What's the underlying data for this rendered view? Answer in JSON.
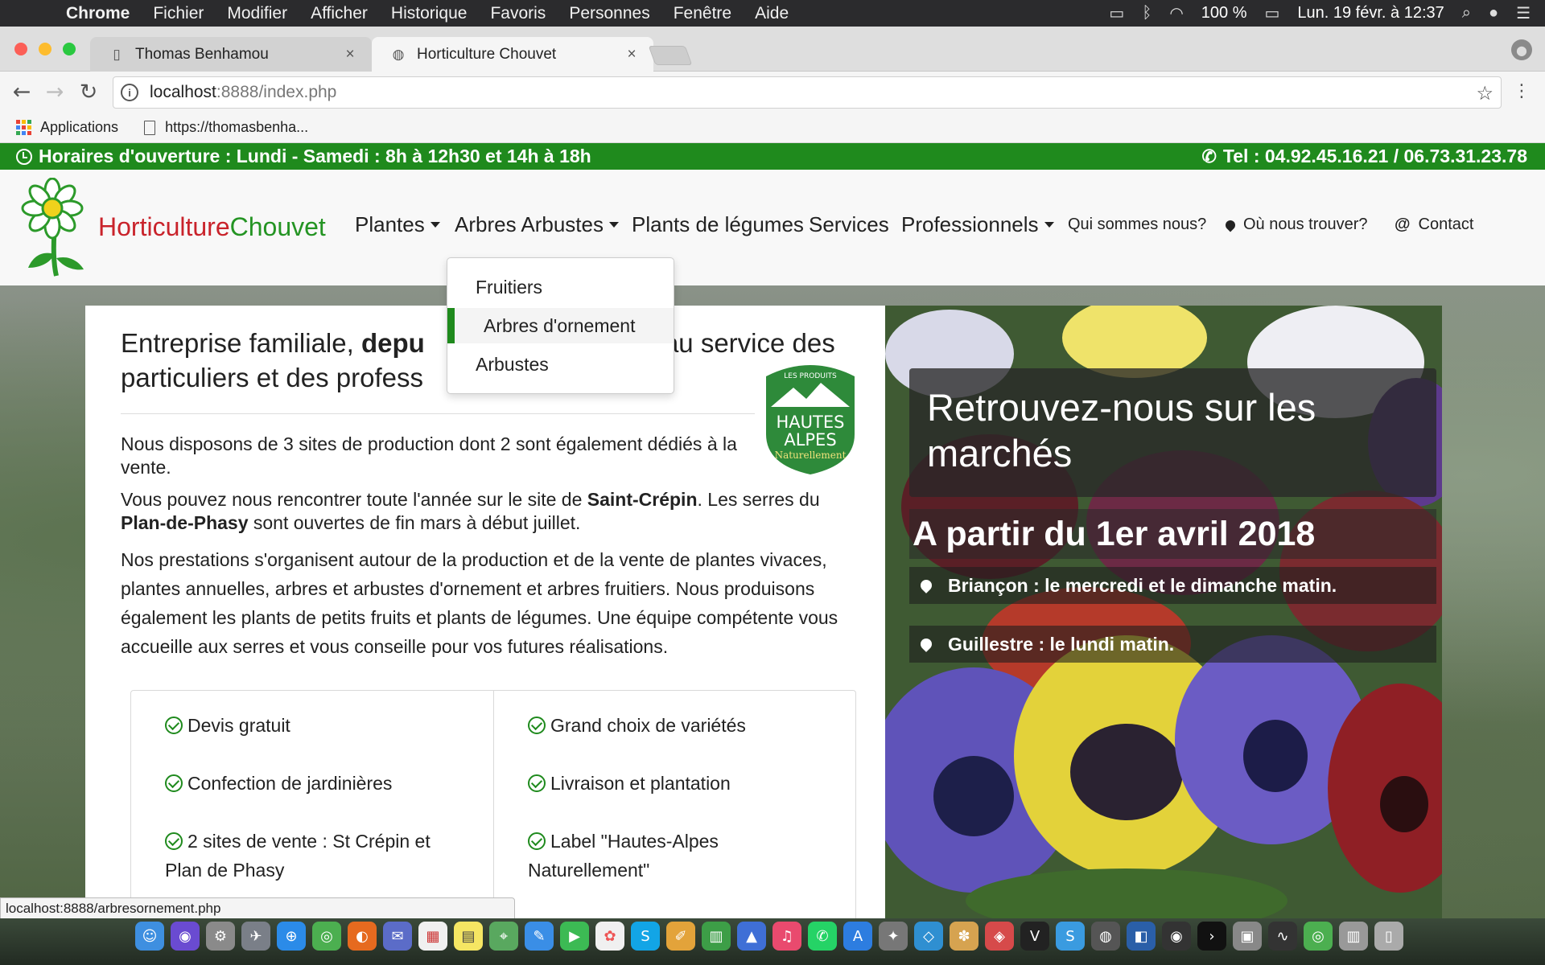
{
  "menubar": {
    "app": "Chrome",
    "items": [
      "Fichier",
      "Modifier",
      "Afficher",
      "Historique",
      "Favoris",
      "Personnes",
      "Fenêtre",
      "Aide"
    ],
    "battery": "100 %",
    "clock": "Lun. 19 févr. à 12:37"
  },
  "tabs": [
    {
      "title": "Thomas Benhamou"
    },
    {
      "title": "Horticulture Chouvet"
    }
  ],
  "omnibox": {
    "host": "localhost",
    "path": ":8888/index.php"
  },
  "bookmarks": [
    {
      "label": "Applications"
    },
    {
      "label": "https://thomasbenha..."
    }
  ],
  "site": {
    "hours": "Horaires d'ouverture : Lundi - Samedi : 8h à 12h30 et 14h à 18h",
    "phone": "Tel : 04.92.45.16.21 / 06.73.31.23.78",
    "brand_part1": "Horticulture",
    "brand_part2": "Chouvet",
    "nav": {
      "plantes": "Plantes",
      "arbres": "Arbres Arbustes",
      "legumes": "Plants de légumes",
      "services": "Services",
      "pros": "Professionnels",
      "qui": "Qui sommes nous?",
      "ou": "Où nous trouver?",
      "contact": "Contact"
    },
    "dropdown": [
      "Fruitiers",
      "Arbres d'ornement",
      "Arbustes"
    ],
    "lead_part1": "Entreprise familiale, ",
    "lead_bold": "depu",
    "lead_part2": " au service des",
    "lead_line2": "particuliers et des profess",
    "badge": {
      "line1": "LES PRODUITS",
      "line2": "HAUTES",
      "line3": "ALPES",
      "line4": "Naturellement"
    },
    "p1": "Nous disposons de 3 sites de production dont 2 sont également dédiés à la vente.",
    "p2_a": "Vous pouvez nous rencontrer toute l'année sur le site de ",
    "p2_b": "Saint-Crépin",
    "p2_c": ". Les serres du ",
    "p2_d": "Plan-de-Phasy",
    "p2_e": " sont ouvertes de fin mars à début juillet.",
    "p3": "Nos prestations s'organisent autour de la production et de la vente de plantes vivaces, plantes annuelles, arbres et arbustes d'ornement et arbres fruitiers. Nous produisons également les plants de petits fruits et plants de légumes. Une équipe compétente vous accueille aux serres et vous conseille pour vos futures réalisations.",
    "features_left": [
      "Devis gratuit",
      "Confection de jardinières",
      "2 sites de vente : St Crépin et Plan de Phasy"
    ],
    "features_right": [
      "Grand choix de variétés",
      "Livraison et plantation",
      "Label \"Hautes-Alpes Naturellement\""
    ],
    "market_title": "Retrouvez-nous sur les marchés",
    "market_date": "A partir du 1er avril 2018",
    "market_rows": [
      "Briançon : le mercredi et le dimanche matin.",
      "Guillestre : le lundi matin."
    ]
  },
  "status_url": "localhost:8888/arbresornement.php",
  "colors": {
    "accent_green": "#1f8a1d",
    "brand_red": "#c9232b"
  }
}
